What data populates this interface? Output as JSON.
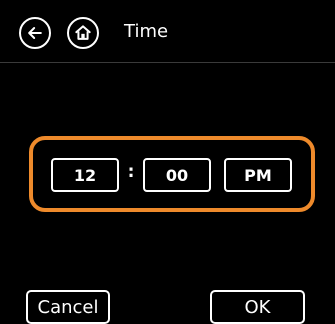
{
  "header": {
    "title": "Time",
    "back_icon": "arrow-left-icon",
    "home_icon": "home-icon"
  },
  "time_picker": {
    "hour": "12",
    "separator": ":",
    "minute": "00",
    "period": "PM",
    "focus_color": "#ee8a2b"
  },
  "actions": {
    "cancel_label": "Cancel",
    "ok_label": "OK"
  }
}
